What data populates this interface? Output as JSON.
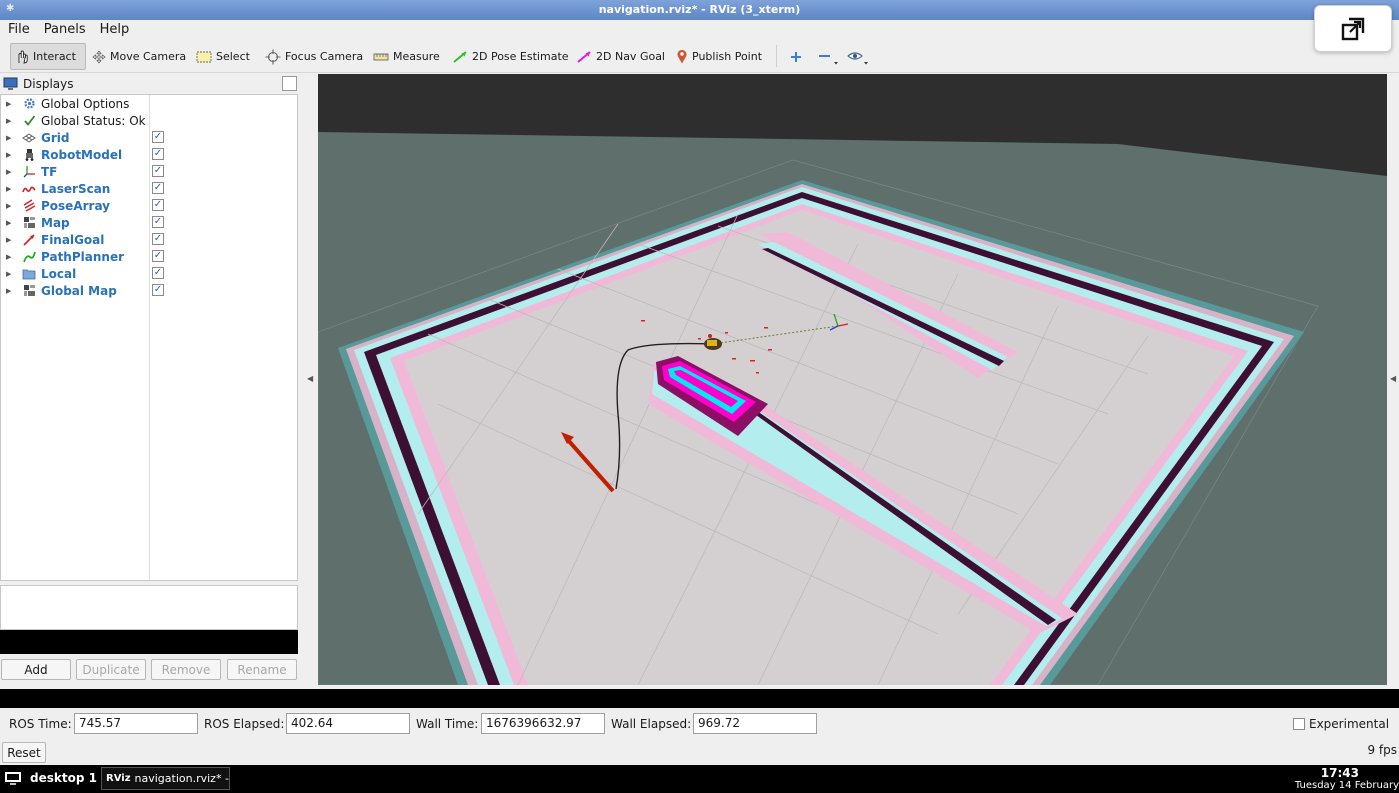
{
  "window": {
    "title": "navigation.rviz* - RViz (3_xterm)"
  },
  "menu": [
    "File",
    "Panels",
    "Help"
  ],
  "toolbar": {
    "interact": "Interact",
    "move_camera": "Move Camera",
    "select": "Select",
    "focus_camera": "Focus Camera",
    "measure": "Measure",
    "pose_estimate": "2D Pose Estimate",
    "nav_goal": "2D Nav Goal",
    "publish_point": "Publish Point"
  },
  "displays": {
    "title": "Displays",
    "items": [
      {
        "label": "Global Options",
        "icon": "gear-icon",
        "checkbox": false,
        "plugin": false
      },
      {
        "label": "Global Status: Ok",
        "icon": "checkmark-icon",
        "checkbox": false,
        "plugin": false
      },
      {
        "label": "Grid",
        "icon": "grid-icon",
        "checkbox": true,
        "checked": true,
        "plugin": true
      },
      {
        "label": "RobotModel",
        "icon": "robot-icon",
        "checkbox": true,
        "checked": true,
        "plugin": true
      },
      {
        "label": "TF",
        "icon": "axes-icon",
        "checkbox": true,
        "checked": true,
        "plugin": true
      },
      {
        "label": "LaserScan",
        "icon": "laser-icon",
        "checkbox": true,
        "checked": true,
        "plugin": true
      },
      {
        "label": "PoseArray",
        "icon": "pose-array-icon",
        "checkbox": true,
        "checked": true,
        "plugin": true
      },
      {
        "label": "Map",
        "icon": "map-icon",
        "checkbox": true,
        "checked": true,
        "plugin": true
      },
      {
        "label": "FinalGoal",
        "icon": "arrow-icon",
        "checkbox": true,
        "checked": true,
        "plugin": true
      },
      {
        "label": "PathPlanner",
        "icon": "path-icon",
        "checkbox": true,
        "checked": true,
        "plugin": true
      },
      {
        "label": "Local",
        "icon": "folder-icon",
        "checkbox": true,
        "checked": true,
        "plugin": true
      },
      {
        "label": "Global Map",
        "icon": "map-icon",
        "checkbox": true,
        "checked": true,
        "plugin": true
      }
    ],
    "buttons": {
      "add": "Add",
      "duplicate": "Duplicate",
      "remove": "Remove",
      "rename": "Rename"
    }
  },
  "time": {
    "ros_time_label": "ROS Time:",
    "ros_time": "745.57",
    "ros_elapsed_label": "ROS Elapsed:",
    "ros_elapsed": "402.64",
    "wall_time_label": "Wall Time:",
    "wall_time": "1676396632.97",
    "wall_elapsed_label": "Wall Elapsed:",
    "wall_elapsed": "969.72",
    "experimental_label": "Experimental",
    "reset_label": "Reset",
    "fps": "9 fps"
  },
  "taskbar": {
    "desktop": "desktop 1",
    "task": "navigation.rviz* -...",
    "clock_time": "17:43",
    "clock_date": "Tuesday 14 February"
  },
  "colors": {
    "background": "#5e6f6c",
    "floor": "#d4d0d2",
    "wall": "#3c0f33",
    "inflation_cyan": "#b5eeee",
    "inflation_pink": "#f1b9d8",
    "accent_magenta": "#ff00cc",
    "path": "#202020",
    "goal_arrow": "#c02000"
  }
}
